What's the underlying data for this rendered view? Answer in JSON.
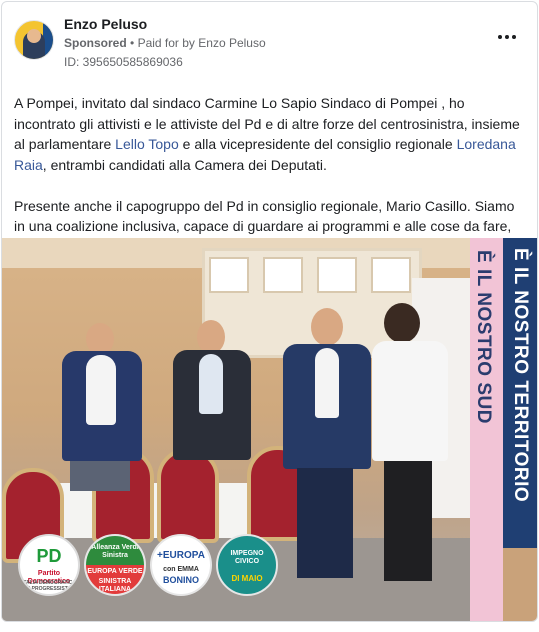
{
  "post": {
    "author": "Enzo Peluso",
    "sponsored_label": "Sponsored",
    "separator": "•",
    "paid_for_prefix": "Paid for by",
    "paid_for_by": "Enzo Peluso",
    "ad_id": "ID: 395650585869036",
    "more_icon": "more-horizontal-icon"
  },
  "body": {
    "p1_part1": "A Pompei, invitato dal sindaco Carmine Lo Sapio Sindaco di Pompei , ho incontrato gli attivisti e le attiviste del Pd e di altre forze del centrosinistra, insieme al parlamentare ",
    "link1": "Lello Topo",
    "p1_part2": " e alla vicepresidente del consiglio regionale ",
    "link2": "Loredana Raia",
    "p1_part3": ", entrambi candidati alla Camera dei Deputati.",
    "p2": "Presente anche il capogruppo del Pd in consiglio regionale, Mario Casillo. Siamo in una coalizione inclusiva, capace di guardare ai programmi e alle cose da fare, alle…"
  },
  "image": {
    "banner_pink_text": "È IL NOSTRO SUD",
    "banner_blue_text": "È IL NOSTRO TERRITORIO",
    "logos": [
      {
        "top": "PD",
        "sub": "Partito Democratico",
        "sub2": "ITALIA DEMOCRATICA E PROGRESSISTA"
      },
      {
        "top": "Alleanza Verdi Sinistra",
        "sub": "EUROPA VERDE",
        "sub2": "SINISTRA ITALIANA"
      },
      {
        "top": "+EUROPA",
        "sub": "con EMMA",
        "sub2": "BONINO"
      },
      {
        "top": "IMPEGNO CIVICO",
        "sub": "DI MAIO",
        "sub2": ""
      }
    ]
  },
  "colors": {
    "link": "#385898",
    "banner_pink": "#f2c4d6",
    "banner_blue": "#1f3f73"
  }
}
